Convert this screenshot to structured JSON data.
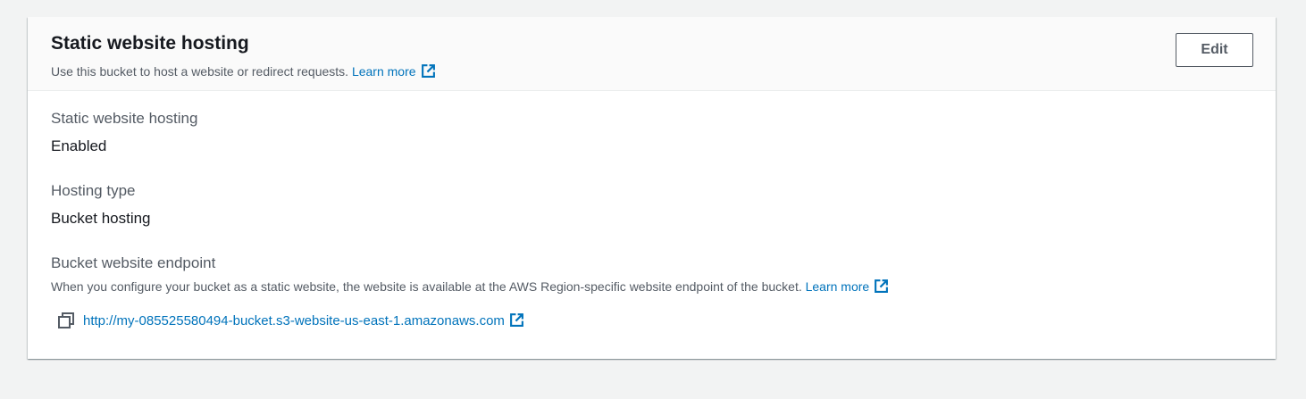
{
  "panel": {
    "title": "Static website hosting",
    "description": "Use this bucket to host a website or redirect requests.",
    "learn_more": "Learn more",
    "edit_label": "Edit"
  },
  "fields": {
    "static_hosting": {
      "label": "Static website hosting",
      "value": "Enabled"
    },
    "hosting_type": {
      "label": "Hosting type",
      "value": "Bucket hosting"
    },
    "endpoint": {
      "label": "Bucket website endpoint",
      "description": "When you configure your bucket as a static website, the website is available at the AWS Region-specific website endpoint of the bucket.",
      "learn_more": "Learn more",
      "url": "http://my-085525580494-bucket.s3-website-us-east-1.amazonaws.com"
    }
  },
  "icons": {
    "external_link": "external-link-icon",
    "copy": "copy-icon"
  },
  "colors": {
    "link": "#0073bb",
    "header_bg": "#fafafa",
    "page_bg": "#f2f3f3",
    "text_primary": "#16191f",
    "text_secondary": "#545b64"
  }
}
